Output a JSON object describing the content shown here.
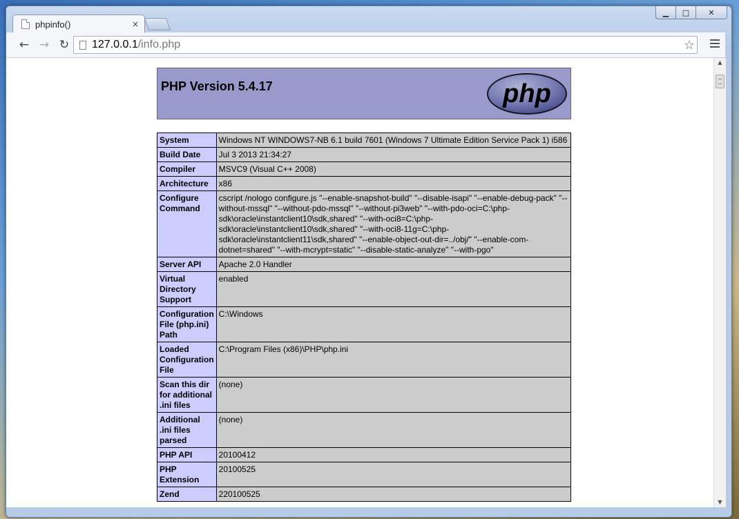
{
  "browser": {
    "tab_title": "phpinfo()",
    "tab_close": "×",
    "url_host": "127.0.0.1",
    "url_path": "/info.php",
    "back_glyph": "←",
    "forward_glyph": "→",
    "reload_glyph": "↻",
    "star_glyph": "☆",
    "icons": [
      "page-icon",
      "back-icon",
      "forward-icon",
      "reload-icon",
      "star-icon",
      "menu-icon",
      "minimize-icon",
      "maximize-icon",
      "close-icon"
    ]
  },
  "window": {
    "minimize": "▁",
    "maximize": "□",
    "close": "✕"
  },
  "php": {
    "title": "PHP Version 5.4.17",
    "logo_text": "php",
    "header_color": "#9999cc",
    "label_color": "#ccccff",
    "value_color": "#cccccc",
    "rows": [
      {
        "label": "System",
        "value": "Windows NT WINDOWS7-NB 6.1 build 7601 (Windows 7 Ultimate Edition Service Pack 1) i586"
      },
      {
        "label": "Build Date",
        "value": "Jul 3 2013 21:34:27"
      },
      {
        "label": "Compiler",
        "value": "MSVC9 (Visual C++ 2008)"
      },
      {
        "label": "Architecture",
        "value": "x86"
      },
      {
        "label": "Configure Command",
        "value": "cscript /nologo configure.js \"--enable-snapshot-build\" \"--disable-isapi\" \"--enable-debug-pack\" \"--without-mssql\" \"--without-pdo-mssql\" \"--without-pi3web\" \"--with-pdo-oci=C:\\php-sdk\\oracle\\instantclient10\\sdk,shared\" \"--with-oci8=C:\\php-sdk\\oracle\\instantclient10\\sdk,shared\" \"--with-oci8-11g=C:\\php-sdk\\oracle\\instantclient11\\sdk,shared\" \"--enable-object-out-dir=../obj/\" \"--enable-com-dotnet=shared\" \"--with-mcrypt=static\" \"--disable-static-analyze\" \"--with-pgo\""
      },
      {
        "label": "Server API",
        "value": "Apache 2.0 Handler"
      },
      {
        "label": "Virtual Directory Support",
        "value": "enabled"
      },
      {
        "label": "Configuration File (php.ini) Path",
        "value": "C:\\Windows"
      },
      {
        "label": "Loaded Configuration File",
        "value": "C:\\Program Files (x86)\\PHP\\php.ini"
      },
      {
        "label": "Scan this dir for additional .ini files",
        "value": "(none)"
      },
      {
        "label": "Additional .ini files parsed",
        "value": "(none)"
      },
      {
        "label": "PHP API",
        "value": "20100412"
      },
      {
        "label": "PHP Extension",
        "value": "20100525"
      },
      {
        "label": "Zend",
        "value": "220100525"
      }
    ]
  }
}
